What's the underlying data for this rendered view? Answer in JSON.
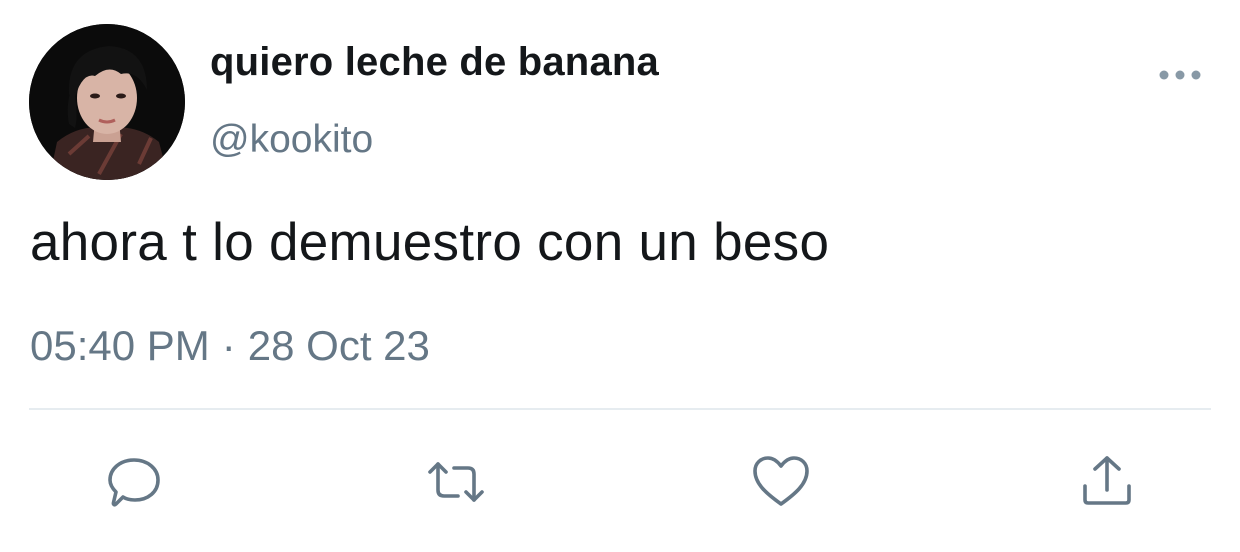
{
  "user": {
    "display_name": "quiero leche de banana",
    "handle": "@kookito"
  },
  "tweet": {
    "text": "ahora t lo demuestro con un beso",
    "time": "05:40 PM",
    "separator": "·",
    "date": "28 Oct 23"
  },
  "icons": {
    "more": "more-dots-icon",
    "reply": "reply-bubble-icon",
    "retweet": "retweet-arrows-icon",
    "like": "heart-icon",
    "share": "share-upload-icon"
  },
  "colors": {
    "text_primary": "#14171a",
    "text_secondary": "#657786",
    "divider": "#e6ecf0",
    "background": "#ffffff"
  }
}
